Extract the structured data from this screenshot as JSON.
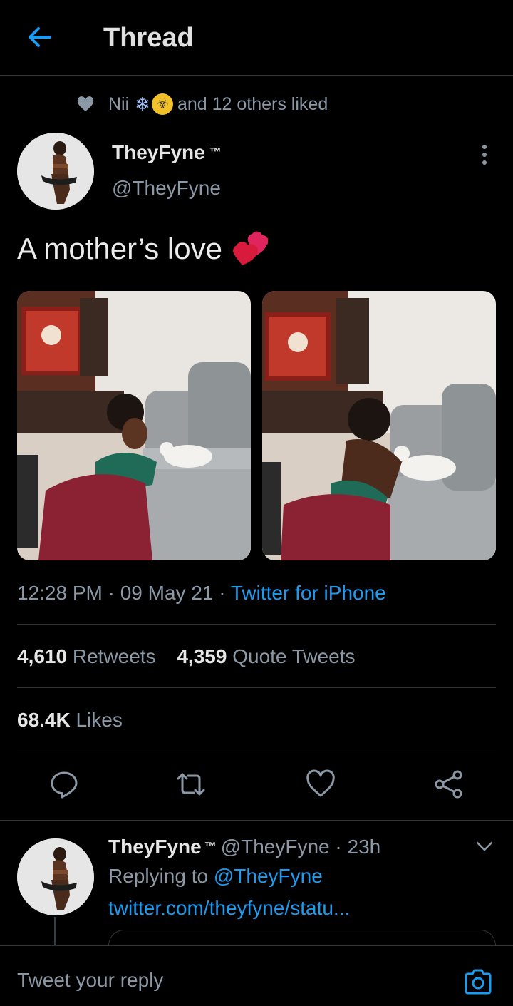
{
  "header": {
    "title": "Thread"
  },
  "liked_by": {
    "name": "Nii",
    "emoji_snow": "❄",
    "emoji_biohazard": "☣",
    "suffix": "and 12 others liked"
  },
  "tweet": {
    "author_name": "TheyFyne",
    "author_tm": "™",
    "author_handle": "@TheyFyne",
    "text": "A mother’s love",
    "time": "12:28 PM · 09 May 21 · ",
    "source": "Twitter for iPhone",
    "retweets": "4,610",
    "retweets_label": "Retweets",
    "quotes": "4,359",
    "quotes_label": "Quote Tweets",
    "likes": "68.4K",
    "likes_label": "Likes"
  },
  "reply": {
    "author_name": "TheyFyne",
    "author_tm": "™",
    "handle_time": "@TheyFyne · 23h",
    "replying_prefix": "Replying to ",
    "replying_to": "@TheyFyne",
    "link": "twitter.com/theyfyne/statu..."
  },
  "composer": {
    "placeholder": "Tweet your reply"
  },
  "icons": {
    "back": "arrow-left-icon",
    "liked": "heart-icon",
    "more": "more-vertical-icon",
    "reply": "reply-icon",
    "retweet": "retweet-icon",
    "like": "like-icon",
    "share": "share-icon",
    "chevron": "chevron-down-icon",
    "camera": "camera-icon"
  },
  "colors": {
    "accent": "#1d9bf0",
    "background": "#000000",
    "muted": "#8b98a5"
  }
}
